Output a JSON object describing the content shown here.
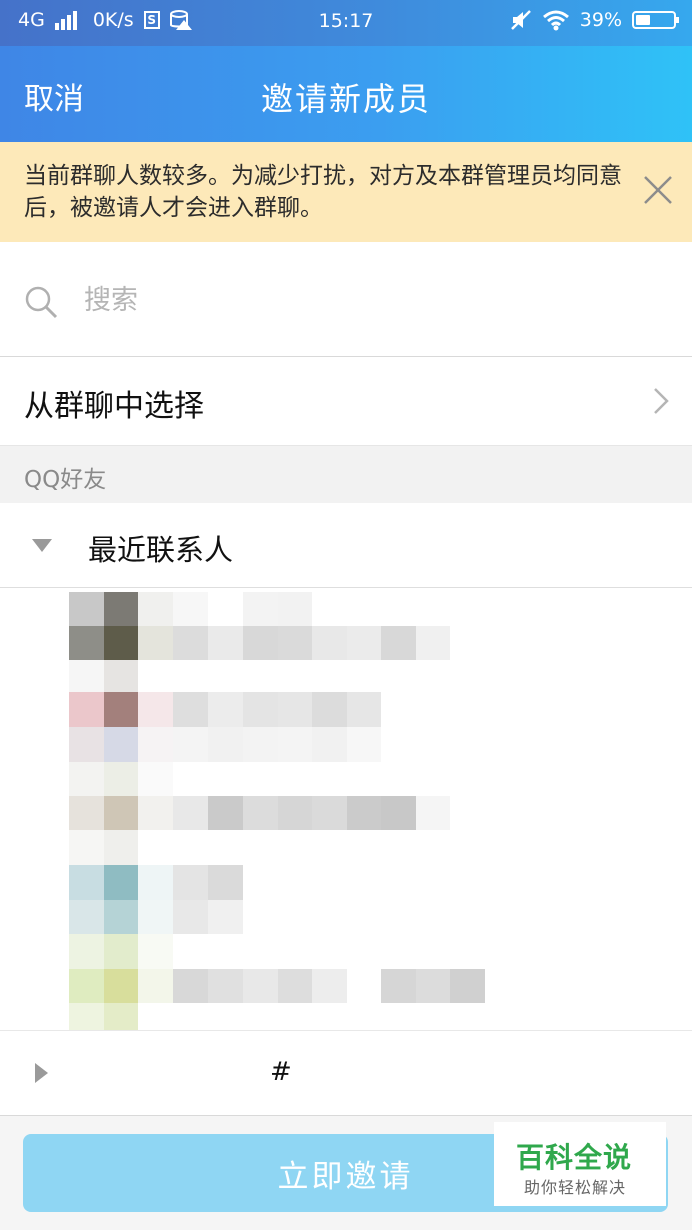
{
  "status_bar": {
    "network": "4G",
    "speed": "0K/s",
    "s_badge": "S",
    "time": "15:17",
    "battery_percent": "39%",
    "battery_level": 0.39
  },
  "header": {
    "cancel_label": "取消",
    "title": "邀请新成员"
  },
  "notice": {
    "text": "当前群聊人数较多。为减少打扰，对方及本群管理员均同意后，被邀请人才会进入群聊。"
  },
  "search": {
    "placeholder": "搜索"
  },
  "choose_from_group": {
    "label": "从群聊中选择"
  },
  "section": {
    "label": "QQ好友"
  },
  "groups": {
    "recent": "最近联系人",
    "hash": "#"
  },
  "footer": {
    "invite_label": "立即邀请"
  },
  "watermark": {
    "title": "百科全说",
    "subtitle": "助你轻松解决"
  },
  "colors": {
    "header_start": "#3f86e6",
    "header_end": "#2fc2f7",
    "notice_bg": "#fde9b9",
    "invite_button": "#8fd6f3",
    "watermark_green": "#2fa84c"
  }
}
